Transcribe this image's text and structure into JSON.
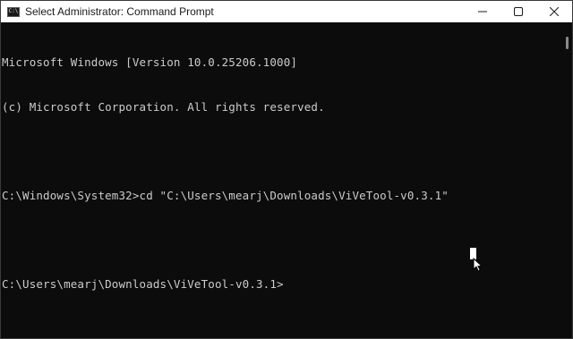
{
  "window": {
    "title": "Select Administrator: Command Prompt",
    "icon": "cmd-icon",
    "icon_text": "C:\\"
  },
  "controls": {
    "minimize_icon": "minimize-icon",
    "maximize_icon": "maximize-icon",
    "close_icon": "close-icon"
  },
  "console": {
    "lines": [
      "Microsoft Windows [Version 10.0.25206.1000]",
      "(c) Microsoft Corporation. All rights reserved.",
      "",
      "C:\\Windows\\System32>cd \"C:\\Users\\mearj\\Downloads\\ViVeTool-v0.3.1\"",
      "",
      "C:\\Users\\mearj\\Downloads\\ViVeTool-v0.3.1>"
    ]
  },
  "colors": {
    "background": "#0c0c0c",
    "text": "#cccccc",
    "titlebar": "#ffffff"
  }
}
